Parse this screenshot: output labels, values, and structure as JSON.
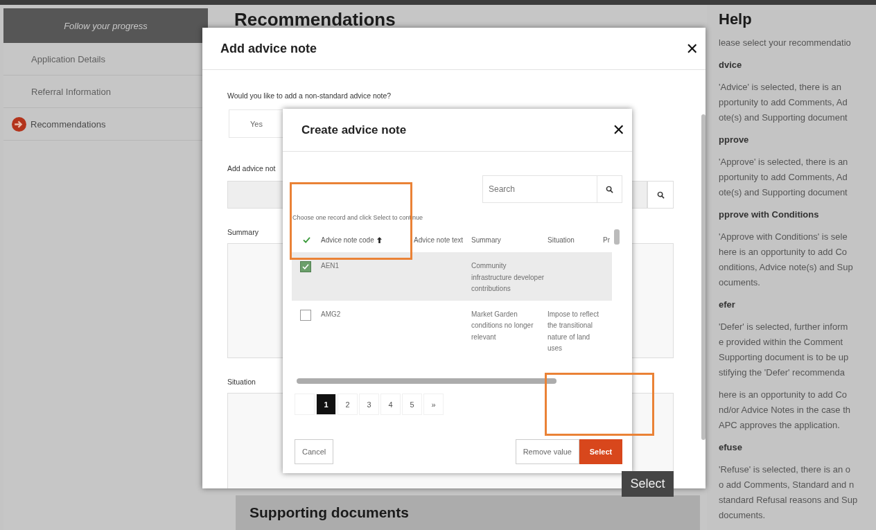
{
  "sidebar": {
    "header": "Follow your progress",
    "items": [
      {
        "label": "Application Details",
        "selected": false
      },
      {
        "label": "Referral Information",
        "selected": false
      },
      {
        "label": "Recommendations",
        "selected": true
      }
    ]
  },
  "main": {
    "heading": "Recommendations",
    "section_heading": "Supporting documents"
  },
  "help": {
    "title": "Help",
    "blocks": [
      {
        "kind": "text",
        "lines": [
          "lease select your recommendatio"
        ]
      },
      {
        "kind": "heading",
        "lines": [
          "dvice"
        ]
      },
      {
        "kind": "text",
        "lines": [
          "'Advice' is selected, there is an",
          "pportunity to add Comments, Ad",
          "ote(s) and Supporting document"
        ]
      },
      {
        "kind": "heading",
        "lines": [
          "pprove"
        ]
      },
      {
        "kind": "text",
        "lines": [
          "'Approve' is selected, there is an",
          "pportunity to add Comments, Ad",
          "ote(s) and Supporting document"
        ]
      },
      {
        "kind": "heading",
        "lines": [
          "pprove with Conditions"
        ]
      },
      {
        "kind": "text",
        "lines": [
          "'Approve with Conditions' is sele",
          "here is an opportunity to add Co",
          "onditions, Advice note(s) and Sup",
          "ocuments."
        ]
      },
      {
        "kind": "heading",
        "lines": [
          "efer"
        ]
      },
      {
        "kind": "text",
        "lines": [
          "'Defer' is selected, further inform",
          "e provided within the Comment",
          "Supporting document is to be up",
          "stifying the 'Defer' recommenda"
        ]
      },
      {
        "kind": "text",
        "lines": [
          "here is an opportunity to add Co",
          "nd/or Advice Notes in the case th",
          "APC approves the application."
        ]
      },
      {
        "kind": "heading",
        "lines": [
          "efuse"
        ]
      },
      {
        "kind": "text",
        "lines": [
          "'Refuse' is selected, there is an o",
          "o add Comments, Standard and n",
          "standard Refusal reasons and Sup",
          "documents."
        ]
      }
    ]
  },
  "add_dialog": {
    "title": "Add advice note",
    "close": "✕",
    "question": "Would you like to add a non-standard advice note?",
    "options": [
      {
        "label": "Yes"
      }
    ],
    "advice_note_label": "Add advice not",
    "summary_label": "Summary",
    "situation_label": "Situation"
  },
  "create_dialog": {
    "title": "Create advice note",
    "close": "✕",
    "search": {
      "placeholder": "Search"
    },
    "instruction": "Choose one record and click Select to continue",
    "columns": [
      {
        "label": "Advice note code",
        "sorted": true
      },
      {
        "label": "Advice note text",
        "sorted": false
      },
      {
        "label": "Summary",
        "sorted": false
      },
      {
        "label": "Situation",
        "sorted": false
      },
      {
        "label": "Pr",
        "sorted": false
      }
    ],
    "rows": [
      {
        "selected": true,
        "code": "AEN1",
        "summary": "Community infrastructure developer contributions"
      },
      {
        "selected": false,
        "code": "AMG2",
        "summary": "Market Garden conditions no longer relevant",
        "situation": "Impose to reflect the transitional nature of land uses"
      }
    ],
    "pages": [
      {
        "label": "1",
        "selected": true
      },
      {
        "label": "2",
        "selected": false
      },
      {
        "label": "3",
        "selected": false
      },
      {
        "label": "4",
        "selected": false
      },
      {
        "label": "5",
        "selected": false
      }
    ],
    "next": "»",
    "buttons": {
      "cancel": "Cancel",
      "remove": "Remove value",
      "select": "Select"
    }
  },
  "tooltip": "Select"
}
